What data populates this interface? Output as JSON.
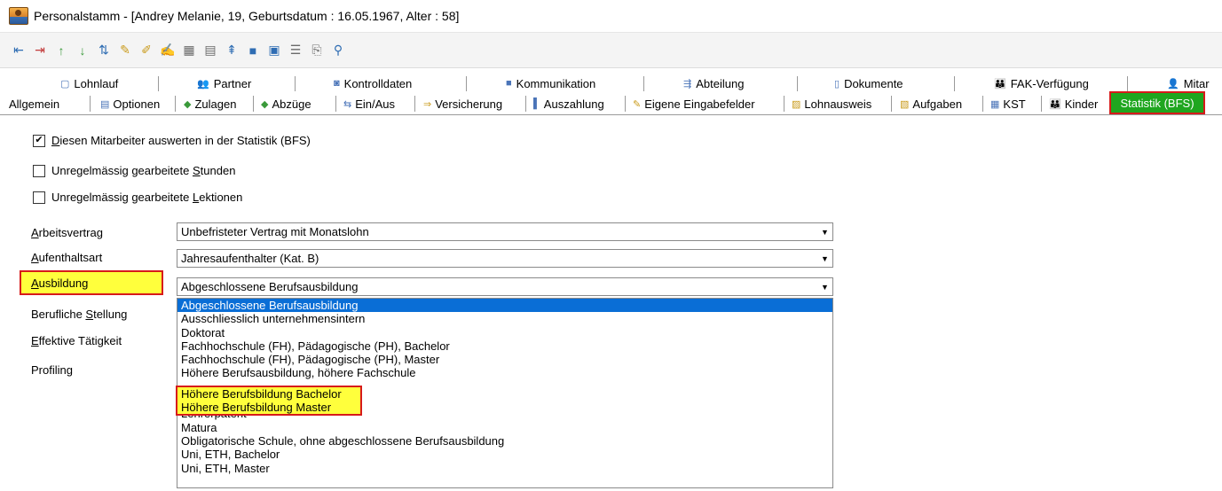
{
  "window": {
    "title": "Personalstamm - [Andrey Melanie, 19, Geburtsdatum : 16.05.1967, Alter : 58]"
  },
  "toolbar": {
    "icons": [
      "first-record-icon",
      "last-record-icon",
      "up-icon",
      "down-icon",
      "sort-icon",
      "spellcheck-icon",
      "spellcheck-alt-icon",
      "edit-icon",
      "grid-icon",
      "grid-alt-icon",
      "filter-icon",
      "bookmark-icon",
      "save-icon",
      "list-icon",
      "preview-icon",
      "search-icon"
    ]
  },
  "tabs_row1": [
    {
      "label": "Lohnlauf",
      "icon": "page-icon"
    },
    {
      "label": "Partner",
      "icon": "partner-icon"
    },
    {
      "label": "Kontrolldaten",
      "icon": "control-icon"
    },
    {
      "label": "Kommunikation",
      "icon": "phone-icon"
    },
    {
      "label": "Abteilung",
      "icon": "department-icon"
    },
    {
      "label": "Dokumente",
      "icon": "document-icon"
    },
    {
      "label": "FAK-Verfügung",
      "icon": "family-icon"
    },
    {
      "label": "Mitar",
      "icon": "employee-icon"
    }
  ],
  "tabs_row2": [
    {
      "label": "Allgemein"
    },
    {
      "label": "Optionen",
      "icon": "options-icon"
    },
    {
      "label": "Zulagen",
      "icon": "bonus-icon"
    },
    {
      "label": "Abzüge",
      "icon": "deduction-icon"
    },
    {
      "label": "Ein/Aus",
      "icon": "in-out-icon"
    },
    {
      "label": "Versicherung",
      "icon": "insurance-icon"
    },
    {
      "label": "Auszahlung",
      "icon": "payment-icon"
    },
    {
      "label": "Eigene Eingabefelder",
      "icon": "custom-fields-icon"
    },
    {
      "label": "Lohnausweis",
      "icon": "salary-cert-icon"
    },
    {
      "label": "Aufgaben",
      "icon": "tasks-icon"
    },
    {
      "label": "KST",
      "icon": "cost-center-icon"
    },
    {
      "label": "Kinder",
      "icon": "children-icon"
    },
    {
      "label": "Statistik (BFS)"
    }
  ],
  "checkboxes": [
    {
      "prefix": "",
      "mnemonic": "D",
      "suffix": "iesen Mitarbeiter auswerten in der Statistik (BFS)",
      "checked": true
    },
    {
      "prefix": "Unregelmässig gearbeitete ",
      "mnemonic": "S",
      "suffix": "tunden",
      "checked": false
    },
    {
      "prefix": "Unregelmässig gearbeitete ",
      "mnemonic": "L",
      "suffix": "ektionen",
      "checked": false
    }
  ],
  "fields": {
    "arbeitsvertrag": {
      "mnemonic": "A",
      "label_rest": "rbeitsvertrag",
      "value": "Unbefristeter Vertrag mit Monatslohn"
    },
    "aufenthaltsart": {
      "mnemonic": "A",
      "label_rest": "ufenthaltsart",
      "value": "Jahresaufenthalter (Kat. B)"
    },
    "ausbildung": {
      "mnemonic": "A",
      "label_rest": "usbildung",
      "value": "Abgeschlossene Berufsausbildung"
    },
    "berufliche_stellung": {
      "label_pre": "Berufliche ",
      "mnemonic": "S",
      "label_rest": "tellung"
    },
    "effektive_taetigkeit": {
      "mnemonic": "E",
      "label_rest": "ffektive Tätigkeit"
    },
    "profiling": {
      "label": "Profiling"
    }
  },
  "dropdown_options": [
    "Abgeschlossene Berufsausbildung",
    "Ausschliesslich unternehmensintern",
    "Doktorat",
    "Fachhochschule (FH), Pädagogische (PH), Bachelor",
    "Fachhochschule (FH), Pädagogische (PH), Master",
    "Höhere Berufsausbildung, höhere Fachschule",
    "Höhere Berufsbildung Bachelor",
    "Höhere Berufsbildung Master",
    "Lehrerpatent",
    "Matura",
    "Obligatorische Schule, ohne abgeschlossene Berufsausbildung",
    "Uni, ETH, Bachelor",
    "Uni, ETH, Master"
  ],
  "colors": {
    "active_tab_bg": "#1fa61f",
    "highlight_border": "#d71a1a",
    "highlight_bg": "#ffff3c",
    "selection_bg": "#0a6ed6"
  }
}
